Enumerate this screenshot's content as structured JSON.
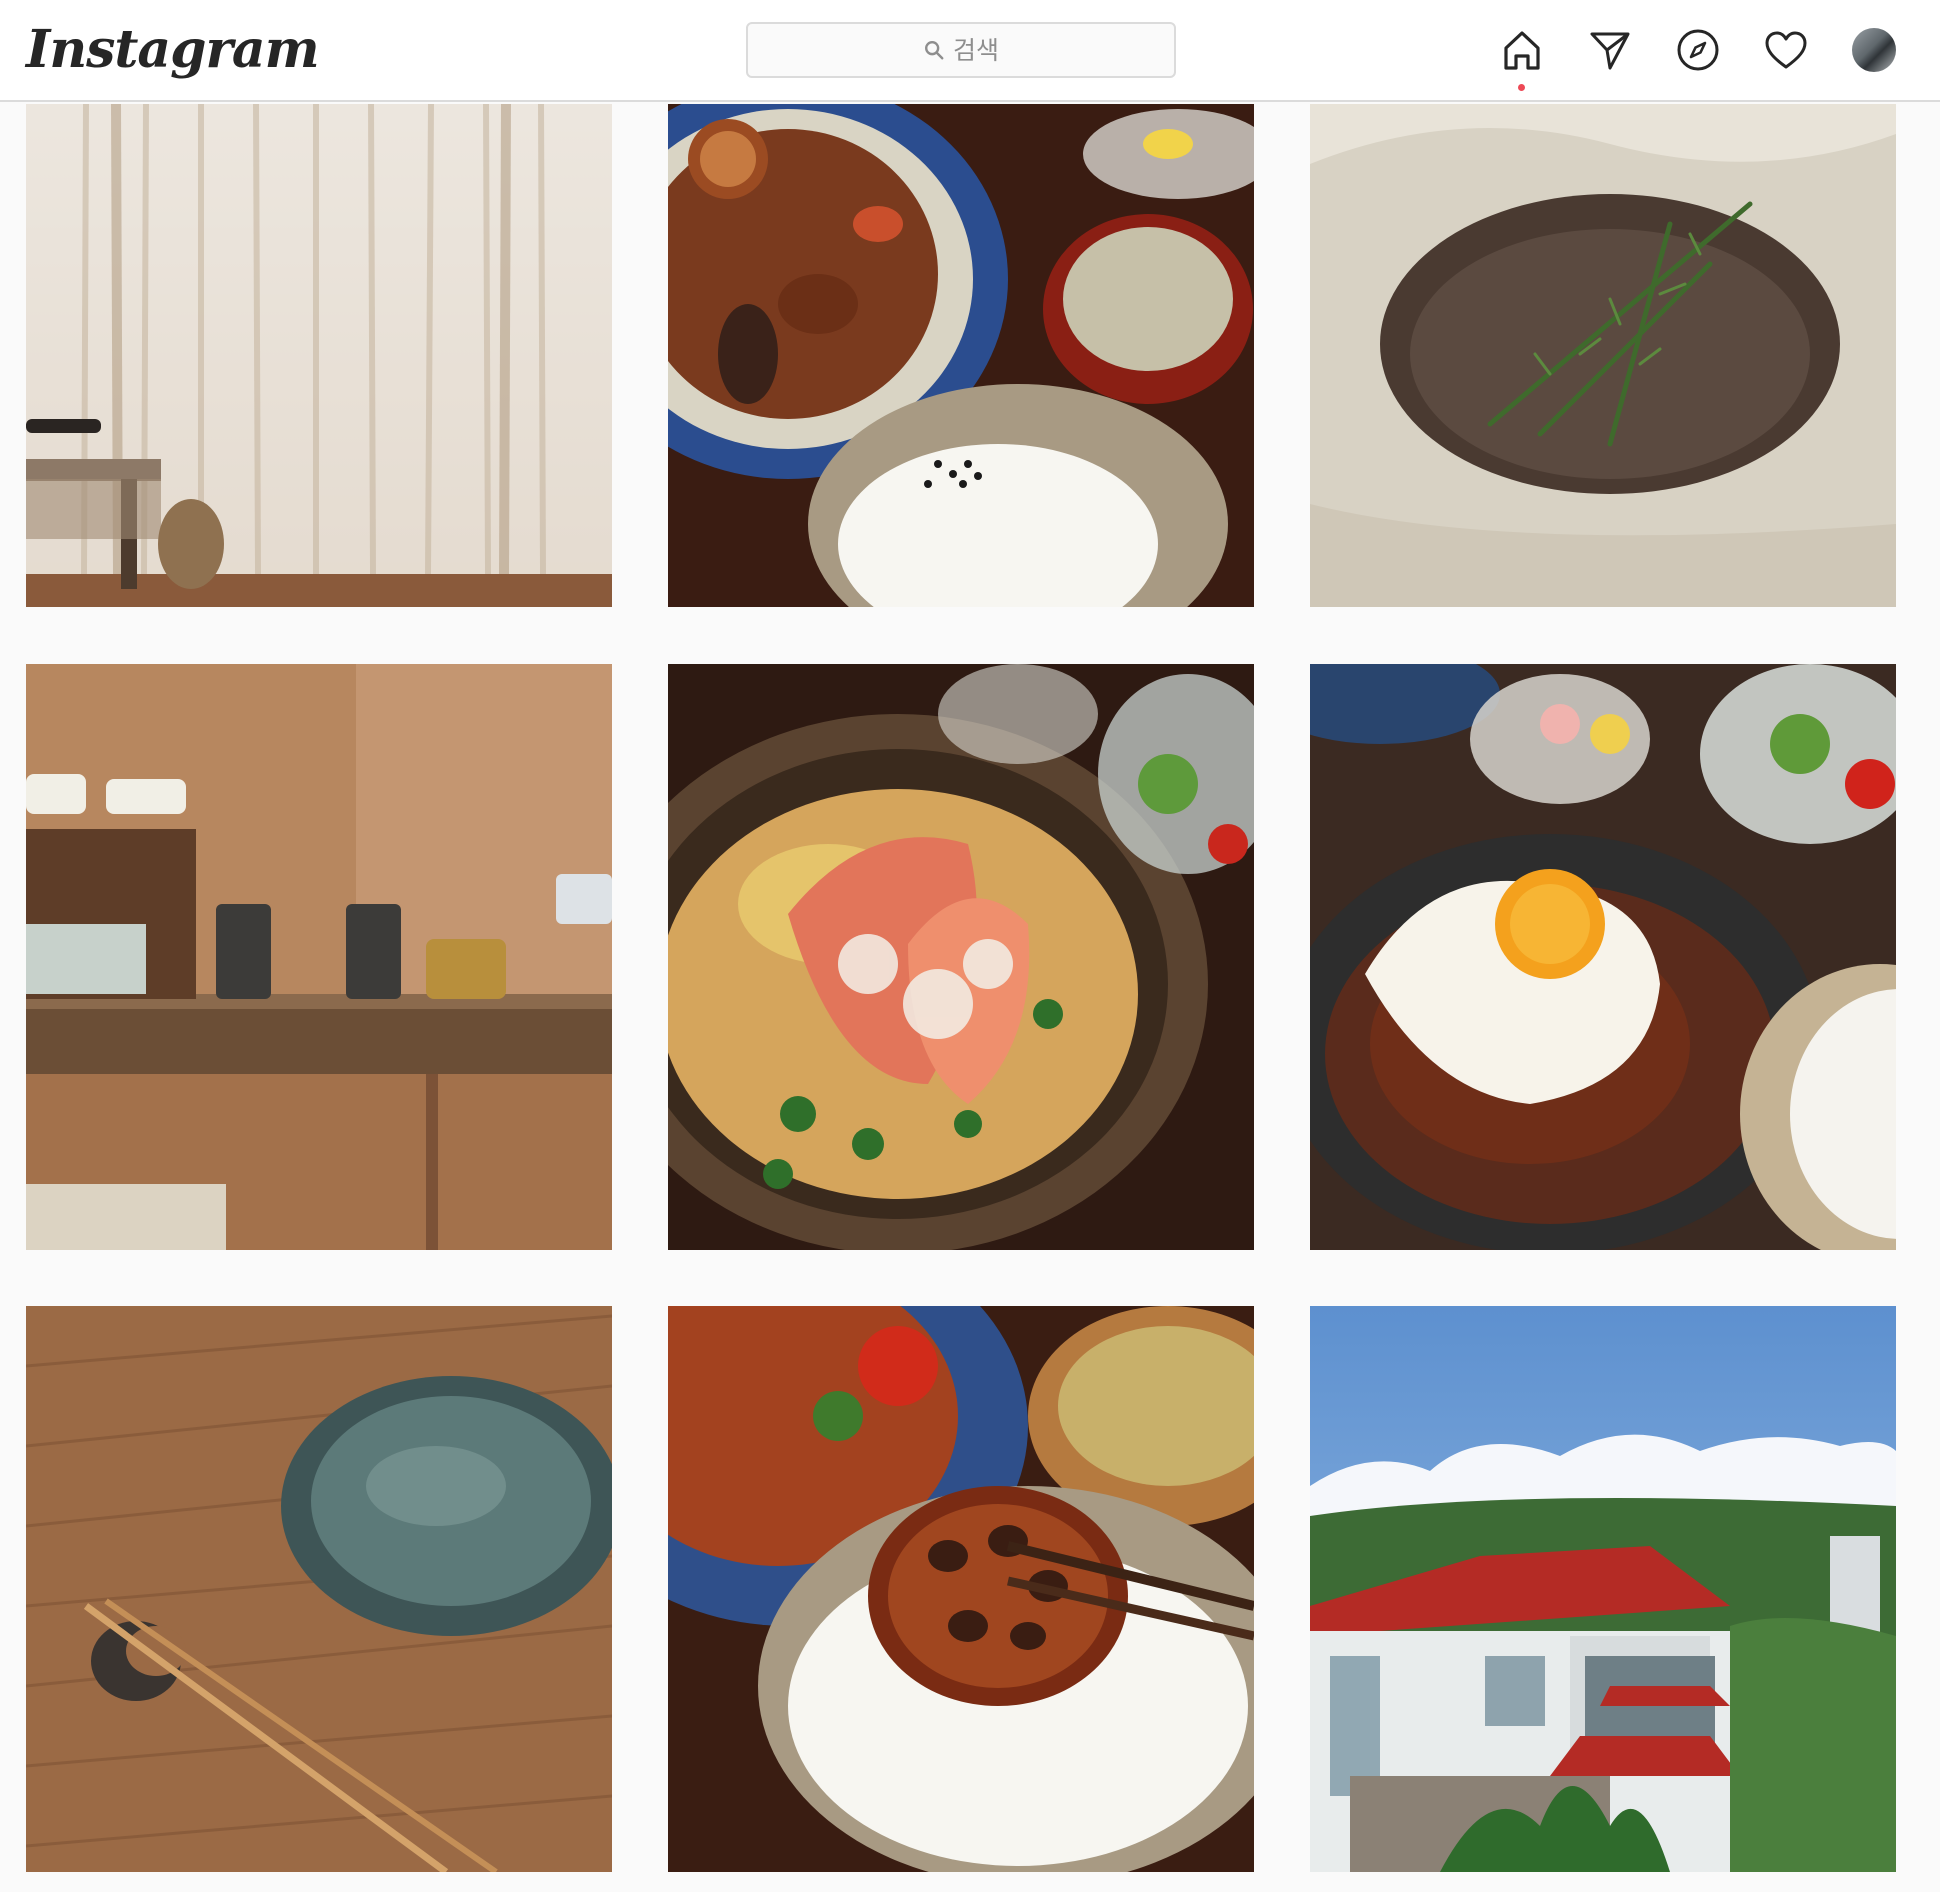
{
  "header": {
    "logo_text": "Instagram",
    "search": {
      "placeholder": "검색",
      "icon": "search-icon"
    },
    "nav_icons": [
      "home-icon",
      "direct-icon",
      "explore-icon",
      "activity-heart-icon",
      "profile-avatar"
    ],
    "active_indicator_color": "#ed4956"
  },
  "posts": [
    {
      "name": "post-curtain-room",
      "row": 1,
      "col": 1
    },
    {
      "name": "post-lotus-stirfry-meal",
      "row": 1,
      "col": 2
    },
    {
      "name": "post-rosemary-bowl",
      "row": 1,
      "col": 3
    },
    {
      "name": "post-mugs-shelf",
      "row": 2,
      "col": 1
    },
    {
      "name": "post-shrimp-curry",
      "row": 2,
      "col": 2
    },
    {
      "name": "post-hamburg-egg",
      "row": 2,
      "col": 3
    },
    {
      "name": "post-green-plate-chopsticks",
      "row": 3,
      "col": 1
    },
    {
      "name": "post-rice-lotus-chopsticks",
      "row": 3,
      "col": 2
    },
    {
      "name": "post-house-sky",
      "row": 3,
      "col": 3
    }
  ],
  "colors": {
    "background": "#fafafa",
    "header_bg": "#ffffff",
    "border": "#dbdbdb",
    "icon": "#262626"
  }
}
